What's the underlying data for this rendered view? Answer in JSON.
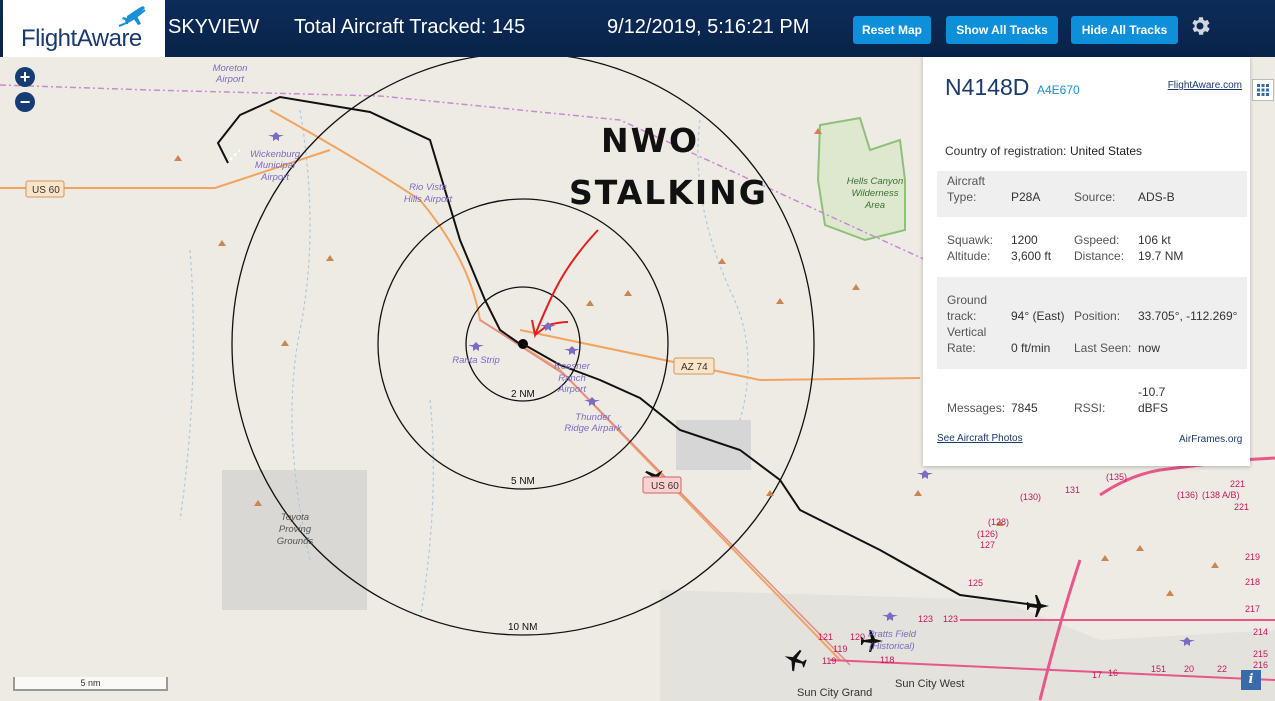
{
  "header": {
    "logo_text": "FlightAware",
    "app_name": "SKYVIEW",
    "total_label": "Total Aircraft Tracked: 145",
    "datetime": "9/12/2019, 5:16:21 PM",
    "buttons": {
      "reset": "Reset Map",
      "show_all": "Show All Tracks",
      "hide_all": "Hide All Tracks"
    }
  },
  "map": {
    "zoom_in": "+",
    "zoom_out": "−",
    "ring_labels": [
      "2 NM",
      "5 NM",
      "10 NM"
    ],
    "roads": [
      "US 60",
      "AZ 74",
      "US 60"
    ],
    "places": {
      "moreton": [
        "Moreton",
        "Airport"
      ],
      "wickenburg": [
        "Wickenburg",
        "Municipal",
        "Airport"
      ],
      "riovista": [
        "Rio Vista",
        "Hills Airport"
      ],
      "hells": [
        "Hells Canyon",
        "Wilderness",
        "Area"
      ],
      "ranta": "Ranta Strip",
      "roesner": [
        "Roesner",
        "Ranch",
        "Airport"
      ],
      "thunder": [
        "Thunder",
        "Ridge Airpark"
      ],
      "toyota": [
        "Toyota",
        "Proving",
        "Grounds"
      ],
      "sun_city_grand": "Sun City Grand",
      "sun_city_west": "Sun City West",
      "pratts": [
        "Pratts Field",
        "(Historical)"
      ]
    },
    "route_numbers": [
      "(135)",
      "(130)",
      "131",
      "(136)",
      "(138 A/B)",
      "221",
      "221",
      "(128)",
      "(126)",
      "127",
      "219",
      "218",
      "217",
      "125",
      "123",
      "123",
      "120",
      "119",
      "119",
      "121",
      "118",
      "17",
      "16",
      "151",
      "20",
      "22",
      "214",
      "215",
      "216"
    ],
    "annotation": [
      "NWO",
      "STALKING"
    ],
    "scale_label": "5 nm",
    "info_icon": "i"
  },
  "panel": {
    "registration": "N4148D",
    "hex": "A4E670",
    "fa_link": "FlightAware.com",
    "country_label": "Country of registration:",
    "country_value": "United States",
    "aircraft_type_label": "Aircraft Type:",
    "aircraft_type_value": "P28A",
    "source_label": "Source:",
    "source_value": "ADS-B",
    "squawk_label": "Squawk:",
    "squawk_value": "1200",
    "gspeed_label": "Gspeed:",
    "gspeed_value": "106 kt",
    "altitude_label": "Altitude:",
    "altitude_value": "3,600 ft",
    "distance_label": "Distance:",
    "distance_value": "19.7 NM",
    "ground_track_label": "Ground track:",
    "ground_track_value": "94° (East)",
    "position_label": "Position:",
    "position_value": "33.705°, -112.269°",
    "vertical_rate_label": "Vertical Rate:",
    "vertical_rate_value": "0 ft/min",
    "last_seen_label": "Last Seen:",
    "last_seen_value": "now",
    "messages_label": "Messages:",
    "messages_value": "7845",
    "rssi_label": "RSSI:",
    "rssi_value": "-10.7 dBFS",
    "photos_link": "See Aircraft Photos",
    "airframes_link": "AirFrames.org"
  },
  "colors": {
    "header_bg": "#082348",
    "button": "#0d8fd9",
    "map_bg": "#eeebe4",
    "route_red": "#e8578a",
    "highway_orange": "#f2a35e",
    "track": "#111111",
    "annotation_red": "#e02020"
  }
}
